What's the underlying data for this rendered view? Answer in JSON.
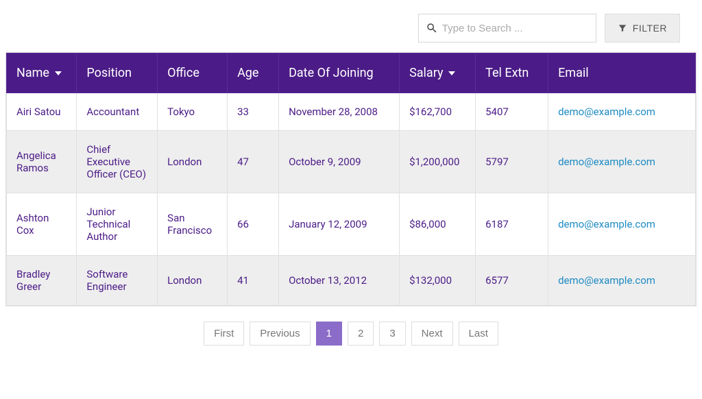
{
  "toolbar": {
    "search_placeholder": "Type to Search ...",
    "filter_label": "FILTER"
  },
  "columns": [
    {
      "label": "Name",
      "sortable": true
    },
    {
      "label": "Position",
      "sortable": false
    },
    {
      "label": "Office",
      "sortable": false
    },
    {
      "label": "Age",
      "sortable": false
    },
    {
      "label": "Date Of Joining",
      "sortable": false
    },
    {
      "label": "Salary",
      "sortable": true
    },
    {
      "label": "Tel Extn",
      "sortable": false
    },
    {
      "label": "Email",
      "sortable": false
    }
  ],
  "rows": [
    {
      "name": "Airi Satou",
      "position": "Accountant",
      "office": "Tokyo",
      "age": "33",
      "date_of_joining": "November 28, 2008",
      "salary": "$162,700",
      "tel_extn": "5407",
      "email": "demo@example.com"
    },
    {
      "name": "Angelica Ramos",
      "position": "Chief Executive Officer (CEO)",
      "office": "London",
      "age": "47",
      "date_of_joining": "October 9, 2009",
      "salary": "$1,200,000",
      "tel_extn": "5797",
      "email": "demo@example.com"
    },
    {
      "name": "Ashton Cox",
      "position": "Junior Technical Author",
      "office": "San Francisco",
      "age": "66",
      "date_of_joining": "January 12, 2009",
      "salary": "$86,000",
      "tel_extn": "6187",
      "email": "demo@example.com"
    },
    {
      "name": "Bradley Greer",
      "position": "Software Engineer",
      "office": "London",
      "age": "41",
      "date_of_joining": "October 13, 2012",
      "salary": "$132,000",
      "tel_extn": "6577",
      "email": "demo@example.com"
    }
  ],
  "pagination": {
    "first": "First",
    "previous": "Previous",
    "pages": [
      "1",
      "2",
      "3"
    ],
    "active_index": 0,
    "next": "Next",
    "last": "Last"
  }
}
